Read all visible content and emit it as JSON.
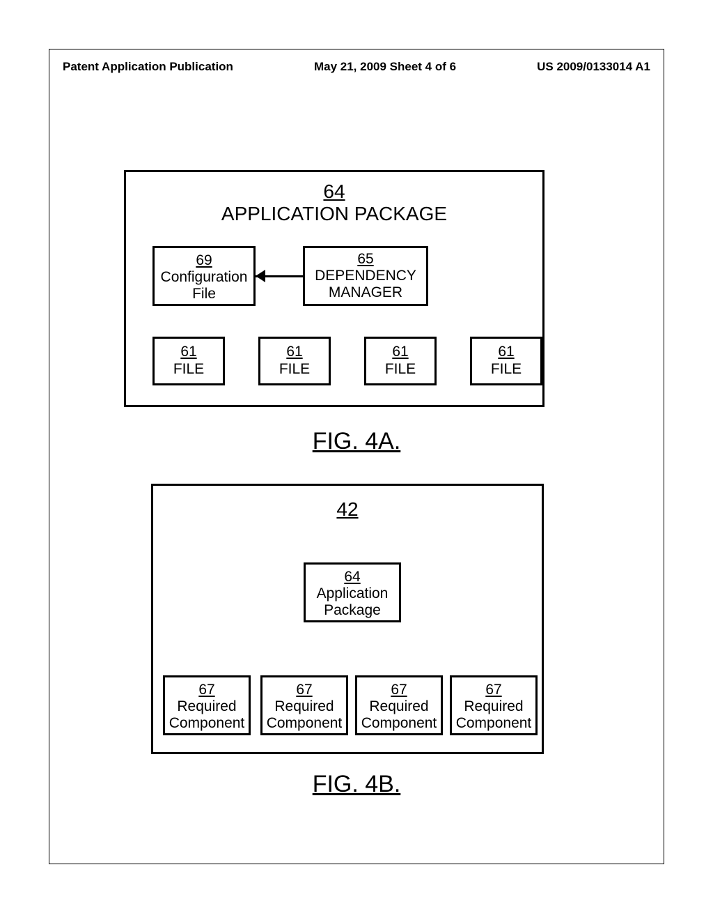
{
  "header": {
    "publication": "Patent Application Publication",
    "date_sheet": "May 21, 2009  Sheet 4 of 6",
    "pubno": "US 2009/0133014 A1"
  },
  "fig4a": {
    "outer": {
      "num": "64",
      "label": "APPLICATION PACKAGE"
    },
    "config": {
      "num": "69",
      "label1": "Configuration",
      "label2": "File"
    },
    "depmgr": {
      "num": "65",
      "label1": "DEPENDENCY",
      "label2": "MANAGER"
    },
    "files": [
      {
        "num": "61",
        "label": "FILE"
      },
      {
        "num": "61",
        "label": "FILE"
      },
      {
        "num": "61",
        "label": "FILE"
      },
      {
        "num": "61",
        "label": "FILE"
      }
    ],
    "caption": "FIG. 4A."
  },
  "fig4b": {
    "outer": {
      "num": "42"
    },
    "app": {
      "num": "64",
      "label1": "Application",
      "label2": "Package"
    },
    "reqs": [
      {
        "num": "67",
        "label1": "Required",
        "label2": "Component"
      },
      {
        "num": "67",
        "label1": "Required",
        "label2": "Component"
      },
      {
        "num": "67",
        "label1": "Required",
        "label2": "Component"
      },
      {
        "num": "67",
        "label1": "Required",
        "label2": "Component"
      }
    ],
    "caption": "FIG. 4B."
  }
}
